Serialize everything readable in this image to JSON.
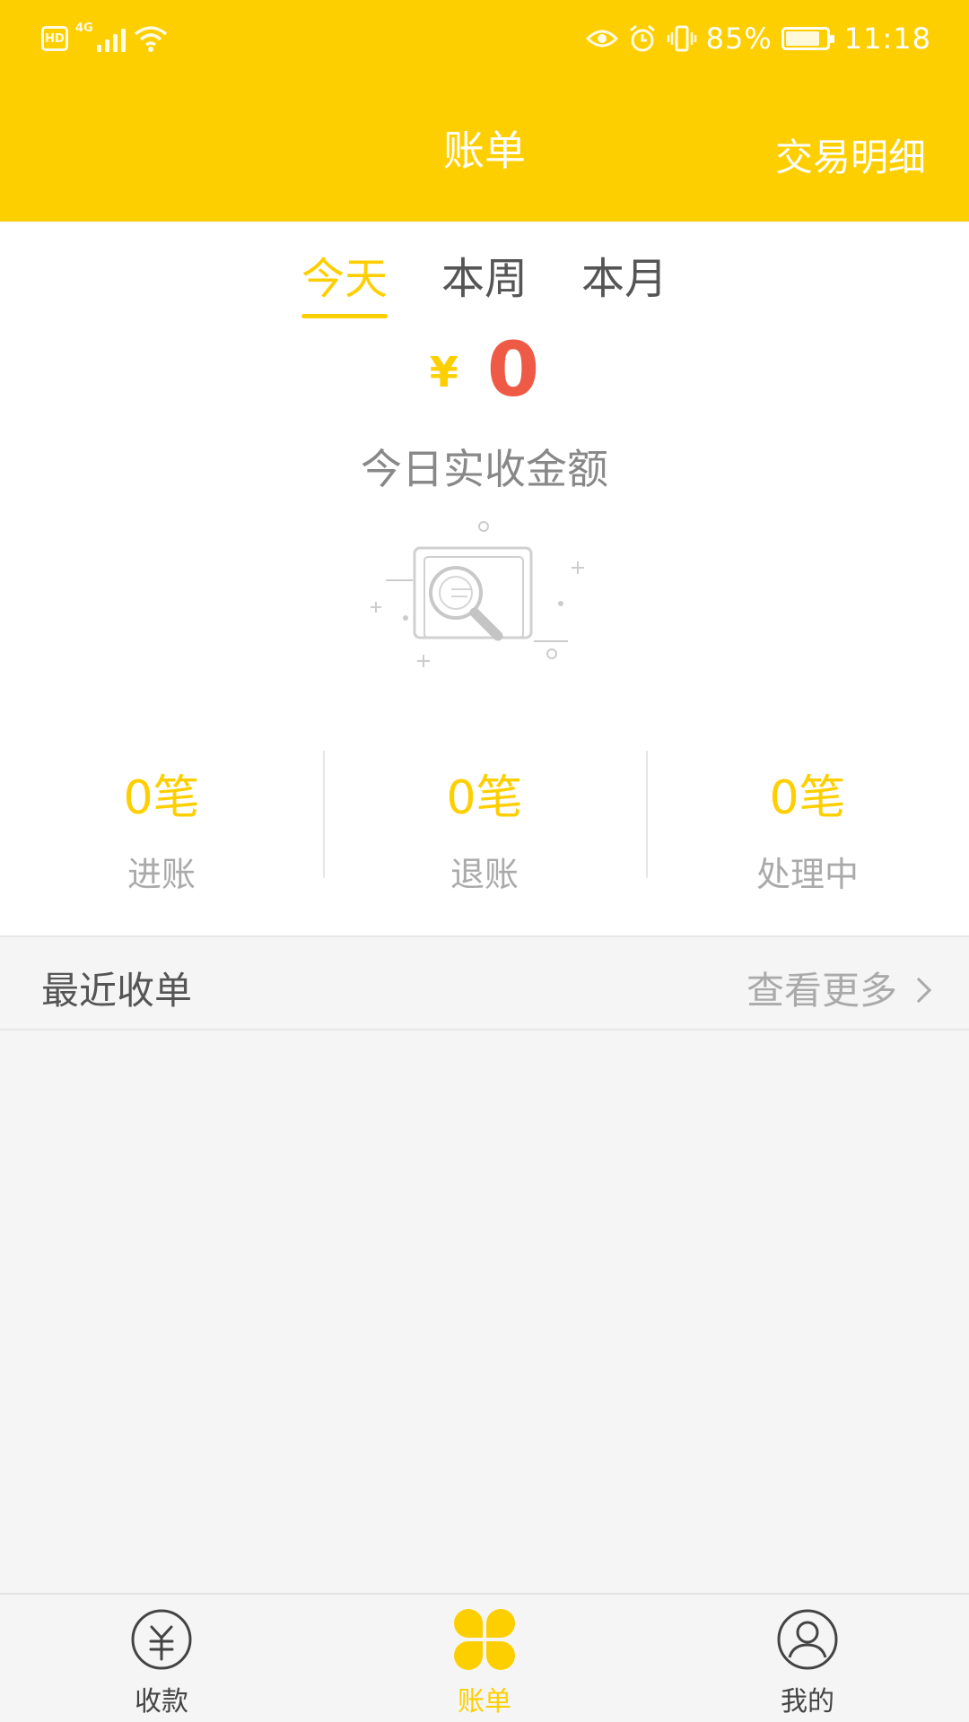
{
  "status_bar": {
    "hd_badge": "HD",
    "network": "4G",
    "battery_percent": "85%",
    "battery_level": 0.85,
    "time": "11:18",
    "icons": [
      "eye-icon",
      "alarm-icon",
      "vibrate-icon",
      "battery-icon",
      "wifi-icon",
      "signal-icon"
    ]
  },
  "nav": {
    "title": "账单",
    "right_action": "交易明细"
  },
  "summary": {
    "tabs": [
      {
        "label": "今天",
        "active": true
      },
      {
        "label": "本周",
        "active": false
      },
      {
        "label": "本月",
        "active": false
      }
    ],
    "currency_symbol": "¥",
    "amount": "0",
    "amount_label": "今日实收金额",
    "stats": [
      {
        "value": "0笔",
        "label": "进账"
      },
      {
        "value": "0笔",
        "label": "退账"
      },
      {
        "value": "0笔",
        "label": "处理中"
      }
    ]
  },
  "recent": {
    "title": "最近收单",
    "more_label": "查看更多"
  },
  "tabbar": {
    "items": [
      {
        "label": "收款",
        "icon": "yuan-circle-icon",
        "active": false
      },
      {
        "label": "账单",
        "icon": "clover-icon",
        "active": true
      },
      {
        "label": "我的",
        "icon": "user-circle-icon",
        "active": false
      }
    ]
  },
  "colors": {
    "brand_yellow": "#fecf00",
    "amount_red": "#ee5a45",
    "background": "#f5f5f5"
  }
}
